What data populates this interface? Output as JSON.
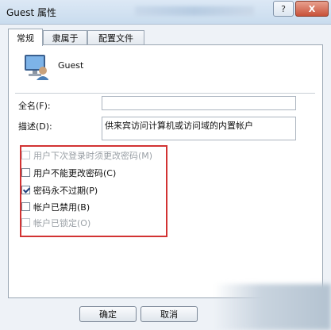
{
  "window": {
    "title": "Guest 属性",
    "help_label": "?",
    "close_label": "X"
  },
  "tabs": [
    {
      "label": "常规",
      "active": true
    },
    {
      "label": "隶属于",
      "active": false
    },
    {
      "label": "配置文件",
      "active": false
    }
  ],
  "user": {
    "name": "Guest",
    "icon": "user-computer-icon"
  },
  "form": {
    "fullname_label": "全名(F):",
    "fullname_value": "",
    "description_label": "描述(D):",
    "description_value": "供来宾访问计算机或访问域的内置帐户"
  },
  "options": [
    {
      "label": "用户下次登录时须更改密码(M)",
      "checked": false,
      "enabled": false
    },
    {
      "label": "用户不能更改密码(C)",
      "checked": false,
      "enabled": true
    },
    {
      "label": "密码永不过期(P)",
      "checked": true,
      "enabled": true
    },
    {
      "label": "帐户已禁用(B)",
      "checked": false,
      "enabled": true
    },
    {
      "label": "帐户已锁定(O)",
      "checked": false,
      "enabled": false
    }
  ],
  "buttons": {
    "ok": "确定",
    "cancel": "取消"
  },
  "colors": {
    "highlight_border": "#d23333",
    "accent": "#1f3f7a"
  }
}
